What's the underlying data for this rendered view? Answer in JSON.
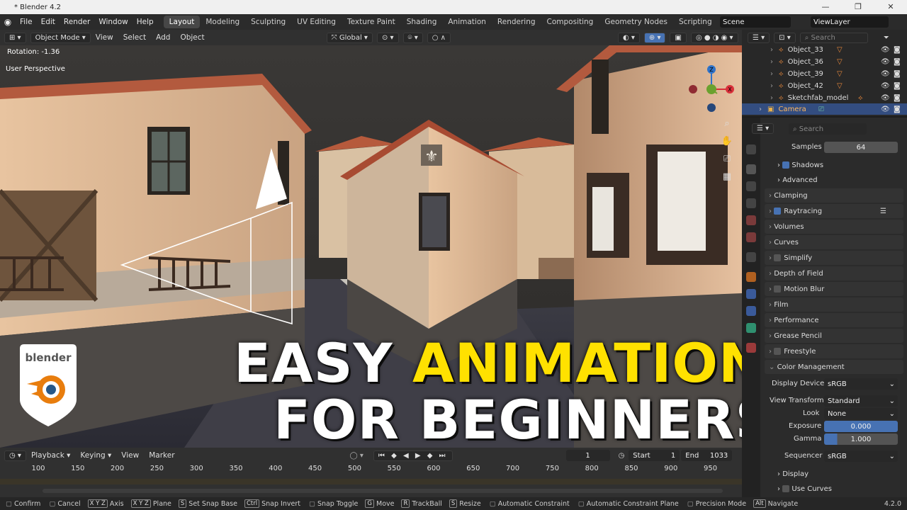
{
  "window": {
    "title": "* Blender 4.2",
    "min": "—",
    "max": "❐",
    "close": "✕"
  },
  "menubar": {
    "items": [
      "File",
      "Edit",
      "Render",
      "Window",
      "Help"
    ],
    "tabs": [
      "Layout",
      "Modeling",
      "Sculpting",
      "UV Editing",
      "Texture Paint",
      "Shading",
      "Animation",
      "Rendering",
      "Compositing",
      "Geometry Nodes",
      "Scripting"
    ],
    "active_tab": "Layout",
    "add_tab": "+",
    "scene": "Scene",
    "view_layer": "ViewLayer"
  },
  "viewport_header": {
    "mode": "Object Mode",
    "menus": [
      "View",
      "Select",
      "Add",
      "Object"
    ],
    "orientation": "Global"
  },
  "viewport": {
    "operator_status": "Rotation: -1.36",
    "view_name": "User Perspective",
    "gizmo_axes": {
      "z": "Z",
      "x": "X"
    },
    "overlay_text_line1_a": "EASY",
    "overlay_text_line1_b": "ANIMATION",
    "overlay_text_line2": "FOR BEGINNERS",
    "logo_text": "blender"
  },
  "outliner": {
    "search_placeholder": "Search",
    "rows": [
      "Object_33",
      "Object_36",
      "Object_39",
      "Object_42",
      "Sketchfab_model",
      "Camera"
    ],
    "selected": "Camera"
  },
  "properties": {
    "search_placeholder": "Search",
    "samples_label": "Samples",
    "samples_value": "64",
    "shadows": "Shadows",
    "advanced": "Advanced",
    "panels": [
      "Clamping",
      "Raytracing",
      "Volumes",
      "Curves",
      "Simplify",
      "Depth of Field",
      "Motion Blur",
      "Film",
      "Performance",
      "Grease Pencil",
      "Freestyle",
      "Color Management"
    ],
    "display_device_label": "Display Device",
    "display_device": "sRGB",
    "view_transform_label": "View Transform",
    "view_transform": "Standard",
    "look_label": "Look",
    "look": "None",
    "exposure_label": "Exposure",
    "exposure": "0.000",
    "gamma_label": "Gamma",
    "gamma": "1.000",
    "sequencer_label": "Sequencer",
    "sequencer": "sRGB",
    "display": "Display",
    "use_curves": "Use Curves"
  },
  "timeline": {
    "menus": [
      "Playback",
      "Keying",
      "View",
      "Marker"
    ],
    "current_frame": "1",
    "start_label": "Start",
    "start": "1",
    "end_label": "End",
    "end": "1033",
    "ticks": [
      "100",
      "150",
      "200",
      "250",
      "300",
      "350",
      "400",
      "450",
      "500",
      "550",
      "600",
      "650",
      "700",
      "750",
      "800",
      "850",
      "900",
      "950"
    ]
  },
  "statusbar": {
    "items": [
      {
        "key": "",
        "label": "Confirm"
      },
      {
        "key": "",
        "label": "Cancel"
      },
      {
        "key": "X Y Z",
        "label": "Axis"
      },
      {
        "key": "X Y Z",
        "label": "Plane"
      },
      {
        "key": "S",
        "label": "Set Snap Base"
      },
      {
        "key": "Ctrl",
        "label": "Snap Invert"
      },
      {
        "key": "",
        "label": "Snap Toggle"
      },
      {
        "key": "G",
        "label": "Move"
      },
      {
        "key": "R",
        "label": "TrackBall"
      },
      {
        "key": "S",
        "label": "Resize"
      },
      {
        "key": "",
        "label": "Automatic Constraint"
      },
      {
        "key": "",
        "label": "Automatic Constraint Plane"
      },
      {
        "key": "",
        "label": "Precision Mode"
      },
      {
        "key": "Alt",
        "label": "Navigate"
      }
    ],
    "version": "4.2.0"
  },
  "colors": {
    "accent_yellow": "#ffe100",
    "selected_row": "#334d80",
    "field_blue": "#4772b3",
    "blender_orange": "#e87d0d",
    "blender_blue": "#265787"
  }
}
